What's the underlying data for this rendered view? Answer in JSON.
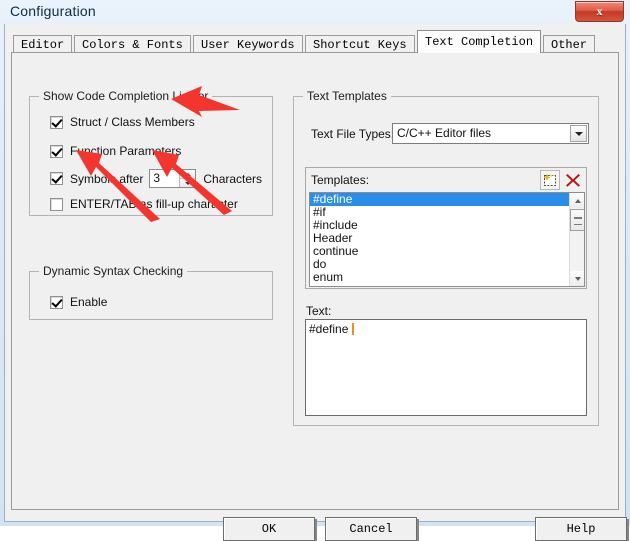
{
  "window": {
    "title": "Configuration",
    "close_label": "x",
    "accent_close": "#c43a24"
  },
  "tabs": [
    {
      "label": "Editor",
      "active": false
    },
    {
      "label": "Colors & Fonts",
      "active": false
    },
    {
      "label": "User Keywords",
      "active": false
    },
    {
      "label": "Shortcut Keys",
      "active": false
    },
    {
      "label": "Text Completion",
      "active": true
    },
    {
      "label": "Other",
      "active": false
    }
  ],
  "code_completion": {
    "group_title": "Show Code Completion List for",
    "items": [
      {
        "label": "Struct / Class Members",
        "checked": true
      },
      {
        "label": "Function Parameters",
        "checked": true
      },
      {
        "label": "Symbols after",
        "checked": true
      },
      {
        "label": "ENTER/TAB as fill-up character",
        "checked": false
      }
    ],
    "symbols_after_value": "3",
    "symbols_after_suffix": "Characters"
  },
  "dynamic_syntax": {
    "group_title": "Dynamic Syntax Checking",
    "enable_label": "Enable",
    "enable_checked": true
  },
  "text_templates": {
    "group_title": "Text Templates",
    "file_types_label": "Text File Types:",
    "file_types_value": "C/C++ Editor files",
    "templates_label": "Templates:",
    "new_icon": "new-template-icon",
    "delete_icon": "delete-template-icon",
    "items": [
      {
        "label": "#define",
        "selected": true
      },
      {
        "label": "#if",
        "selected": false
      },
      {
        "label": "#include",
        "selected": false
      },
      {
        "label": "Header",
        "selected": false
      },
      {
        "label": "continue",
        "selected": false
      },
      {
        "label": "do",
        "selected": false
      },
      {
        "label": "enum",
        "selected": false
      }
    ],
    "text_label": "Text:",
    "text_value": "#define ",
    "selection_color": "#2a8ee8",
    "caret_color": "#e8921f"
  },
  "buttons": {
    "ok": "OK",
    "cancel": "Cancel",
    "help": "Help"
  },
  "annotations": {
    "color": "#f4352e",
    "arrow_count": 3
  }
}
